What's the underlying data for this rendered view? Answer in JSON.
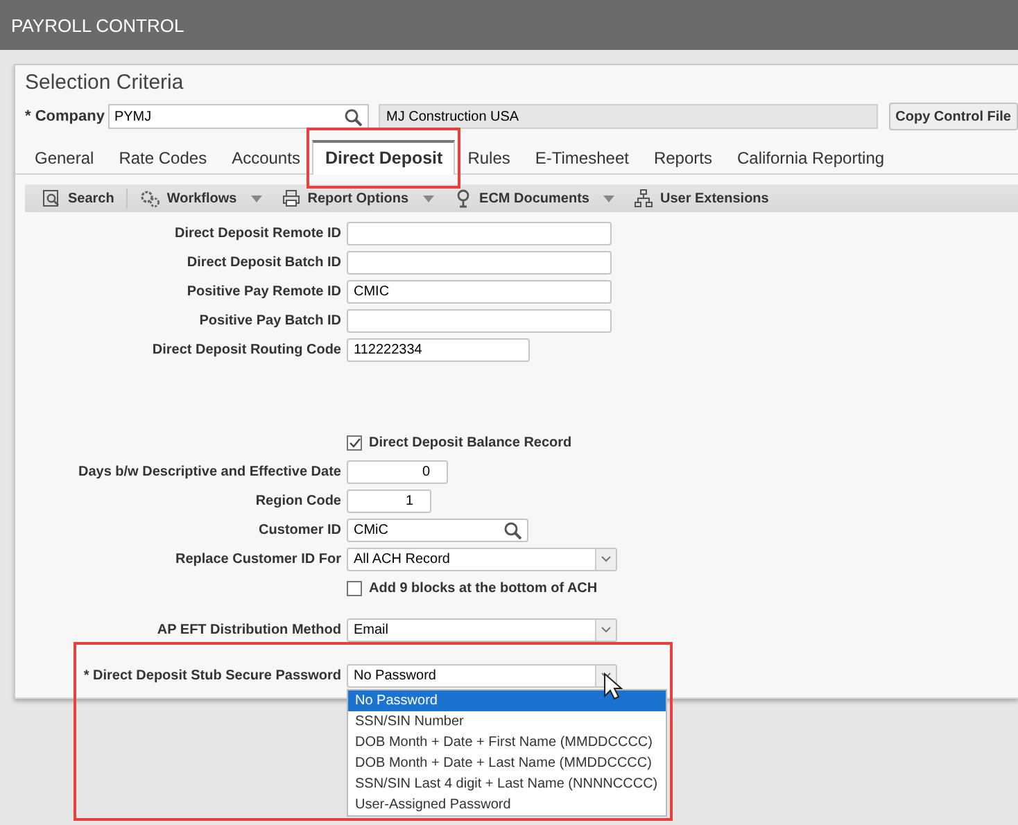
{
  "window": {
    "title": "PAYROLL CONTROL"
  },
  "selection": {
    "title": "Selection Criteria",
    "company_label": "* Company",
    "company_value": "PYMJ",
    "company_name": "MJ Construction USA",
    "copy_button": "Copy Control File"
  },
  "tabs": [
    {
      "label": "General",
      "selected": false
    },
    {
      "label": "Rate Codes",
      "selected": false
    },
    {
      "label": "Accounts",
      "selected": false
    },
    {
      "label": "Direct Deposit",
      "selected": true,
      "highlighted": true
    },
    {
      "label": "Rules",
      "selected": false
    },
    {
      "label": "E-Timesheet",
      "selected": false
    },
    {
      "label": "Reports",
      "selected": false
    },
    {
      "label": "California Reporting",
      "selected": false
    }
  ],
  "toolbar": [
    {
      "label": "Search",
      "kind": "search",
      "menu": false
    },
    {
      "label": "Workflows",
      "kind": "gears",
      "menu": true
    },
    {
      "label": "Report Options",
      "kind": "printer",
      "menu": true
    },
    {
      "label": "ECM Documents",
      "kind": "pin",
      "menu": true
    },
    {
      "label": "User Extensions",
      "kind": "tree",
      "menu": false
    }
  ],
  "fields": [
    {
      "kind": "text",
      "label": "Direct Deposit Remote ID"
    },
    {
      "kind": "text",
      "label": "Direct Deposit Batch ID"
    },
    {
      "kind": "text",
      "label": "Positive Pay Remote ID",
      "value": "CMIC"
    },
    {
      "kind": "text",
      "label": "Positive Pay Batch ID"
    },
    {
      "kind": "text",
      "label": "Direct Deposit Routing Code",
      "value": "112222334"
    },
    {
      "kind": "checkbox",
      "label": "Direct Deposit Balance Record",
      "checked": true
    },
    {
      "kind": "number",
      "label": "Days b/w Descriptive and Effective Date",
      "value": "0"
    },
    {
      "kind": "number",
      "label": "Region Code",
      "value": "1"
    },
    {
      "kind": "lookup",
      "label": "Customer ID",
      "value": "CMiC"
    },
    {
      "kind": "select",
      "label": "Replace Customer ID For",
      "value": "All ACH Record"
    },
    {
      "kind": "checkbox",
      "label": "Add 9 blocks at the bottom of ACH",
      "checked": false
    },
    {
      "kind": "select",
      "label": "AP EFT Distribution Method",
      "value": "Email"
    },
    {
      "kind": "select",
      "label": "* Direct Deposit Stub Secure Password",
      "value": "No Password",
      "open": true,
      "highlighted": true
    }
  ],
  "dropdown": [
    {
      "label": "No Password",
      "selected": true
    },
    {
      "label": "SSN/SIN Number",
      "selected": false
    },
    {
      "label": "DOB Month + Date + First Name (MMDDCCCC)",
      "selected": false
    },
    {
      "label": "DOB Month + Date + Last Name (MMDDCCCC)",
      "selected": false
    },
    {
      "label": "SSN/SIN Last 4 digit + Last Name (NNNNCCCC)",
      "selected": false
    },
    {
      "label": "User-Assigned Password",
      "selected": false
    }
  ]
}
